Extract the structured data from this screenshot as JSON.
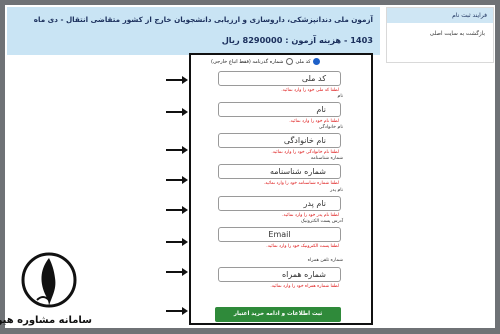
{
  "header": {
    "title_line1": "آزمون ملی دندانپزشکی، داروسازی و ارزیابی دانشجویان خارج از کشور متقاضی انتقال - دی ماه",
    "title_line2": "1403 - هزینه آزمون : 8290000 ریال"
  },
  "sidebar": {
    "heading": "فرایند ثبت نام",
    "back_link": "بازگشت به سایت اصلی"
  },
  "form": {
    "radio_option1": "کد ملی",
    "radio_option2": "شماره گذرنامه (فقط اتباع خارجی)",
    "fields": [
      {
        "label": "",
        "placeholder": "کد ملی",
        "hint": "لطفا کد ملی خود را وارد نمائید."
      },
      {
        "label": "نام",
        "placeholder": "نام",
        "hint": "لطفا نام خود را وارد نمائید."
      },
      {
        "label": "نام خانوادگی",
        "placeholder": "نام خانوادگی",
        "hint": "لطفا نام خانوادگی خود را وارد نمائید."
      },
      {
        "label": "شماره شناسنامه",
        "placeholder": "شماره شناسنامه",
        "hint": "لطفا شماره شناسنامه خود را وارد نمائید."
      },
      {
        "label": "نام پدر",
        "placeholder": "نام پدر",
        "hint": "لطفا نام پدر خود را وارد نمائید."
      },
      {
        "label": "آدرس پست الکترونیک",
        "placeholder": "Email",
        "hint": "لطفا پست الکترونیک خود را وارد نمائید."
      },
      {
        "label": "شماره تلفن همراه",
        "placeholder": "شماره همراه",
        "hint": "لطفا شماره همراه خود را وارد نمائید."
      }
    ],
    "submit_label": "ثبت اطلاعات و ادامه خرید اعتبار"
  },
  "branding": {
    "logo_text": "سامانه مشاوره هیوا"
  },
  "colors": {
    "banner_bg": "#c9e4f4",
    "submit_bg": "#2f8a3a",
    "frame_bg": "#6f7276"
  }
}
